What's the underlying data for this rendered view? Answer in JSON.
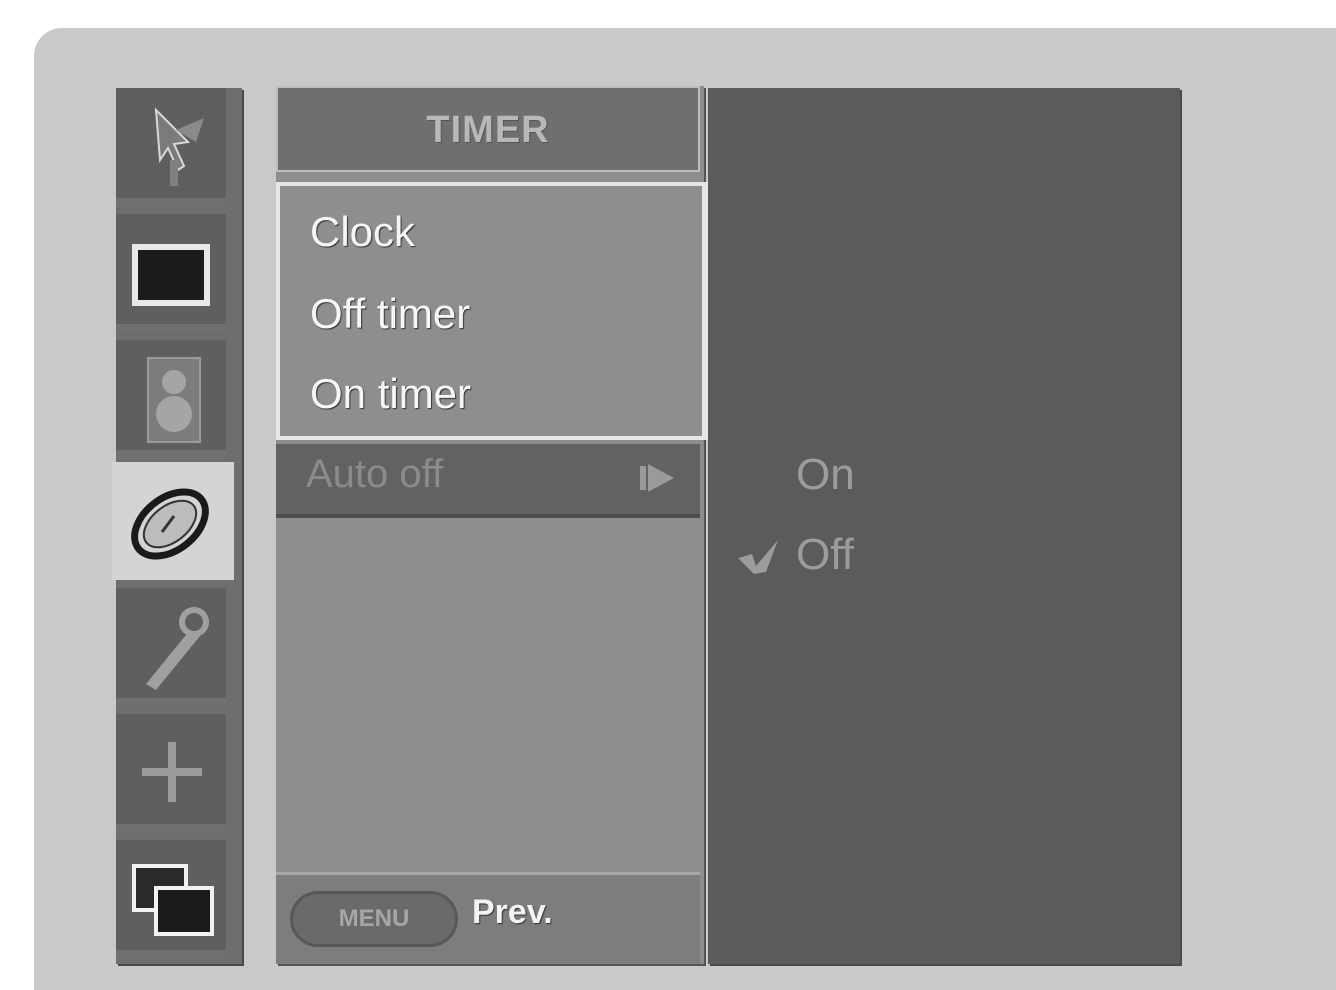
{
  "menu": {
    "title": "TIMER",
    "items": [
      {
        "label": "Clock"
      },
      {
        "label": "Off timer"
      },
      {
        "label": "On timer"
      }
    ],
    "selected_item": {
      "label": "Auto off"
    }
  },
  "submenu": {
    "options": [
      {
        "label": "On",
        "checked": false
      },
      {
        "label": "Off",
        "checked": true
      }
    ]
  },
  "footer": {
    "key_label": "MENU",
    "prev_label": "Prev."
  },
  "sidebar": {
    "icons": [
      "antenna-icon",
      "picture-icon",
      "sound-icon",
      "timer-icon",
      "special-icon",
      "screen-icon",
      "pip-icon"
    ],
    "active_index": 3
  }
}
